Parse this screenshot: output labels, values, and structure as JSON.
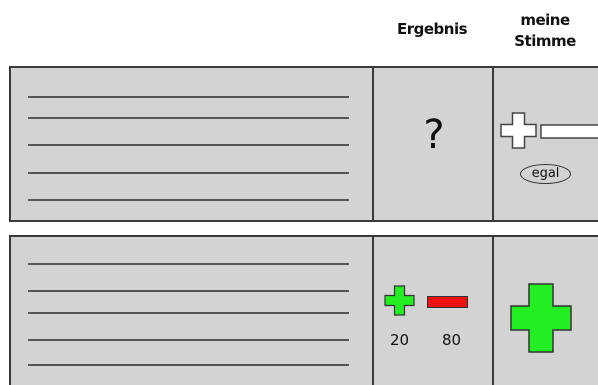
{
  "header": {
    "result_label": "Ergebnis",
    "vote_label_line1": "meine",
    "vote_label_line2": "Stimme"
  },
  "rows": [
    {
      "result": "?",
      "vote_options": {
        "neutral_label": "egal"
      }
    },
    {
      "result_yes": "20",
      "result_no": "80",
      "my_vote": "yes"
    }
  ],
  "colors": {
    "panel": "#d3d3d3",
    "border": "#3a3a3a",
    "yes_green": "#22ee22",
    "no_red": "#ee1111"
  }
}
